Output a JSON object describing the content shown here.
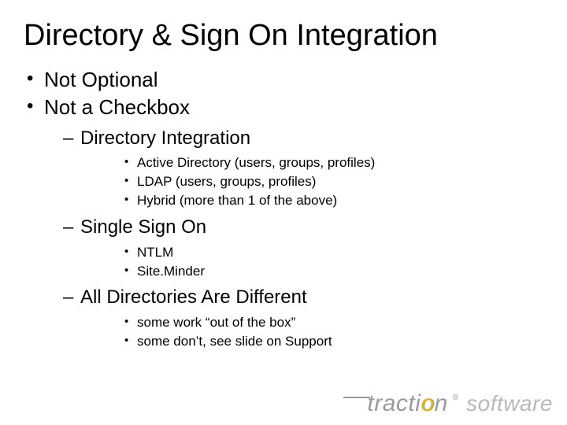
{
  "title": "Directory & Sign On Integration",
  "bullets_l1": [
    "Not Optional",
    "Not a Checkbox"
  ],
  "sections": [
    {
      "heading": "Directory Integration",
      "items": [
        "Active Directory (users, groups, profiles)",
        "LDAP (users, groups, profiles)",
        "Hybrid (more than 1 of the above)"
      ]
    },
    {
      "heading": "Single Sign On",
      "items": [
        "NTLM",
        "Site.Minder"
      ]
    },
    {
      "heading": "All Directories Are Different",
      "items": [
        "some work “out of the box”",
        "some don’t, see slide on Support"
      ]
    }
  ],
  "logo": {
    "brand_pre": "tracti",
    "brand_o": "o",
    "brand_post": "n",
    "reg": "®",
    "soft": "software"
  }
}
